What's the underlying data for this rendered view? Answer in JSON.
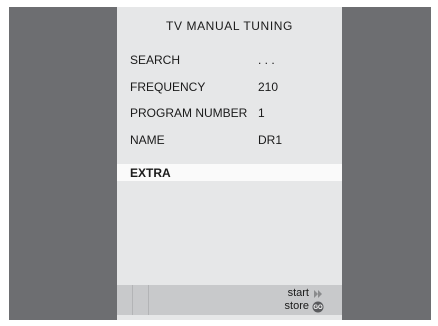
{
  "menu": {
    "title": "TV MANUAL TUNING",
    "rows": [
      {
        "label": "SEARCH",
        "value": ". . ."
      },
      {
        "label": "FREQUENCY",
        "value": "210"
      },
      {
        "label": "PROGRAM NUMBER",
        "value": "1"
      },
      {
        "label": "NAME",
        "value": "DR1"
      }
    ],
    "highlighted": {
      "label": "EXTRA"
    }
  },
  "footer": {
    "hints": [
      {
        "label": "start",
        "icon": "fast-forward-icon"
      },
      {
        "label": "store",
        "icon": "go-icon",
        "icon_text": "GO"
      }
    ]
  },
  "colors": {
    "frame": "#6d6e71",
    "panel": "#e6e7e8",
    "highlight": "#fafafa",
    "bottombar": "#c8c9cb",
    "text": "#1a1a1a"
  }
}
